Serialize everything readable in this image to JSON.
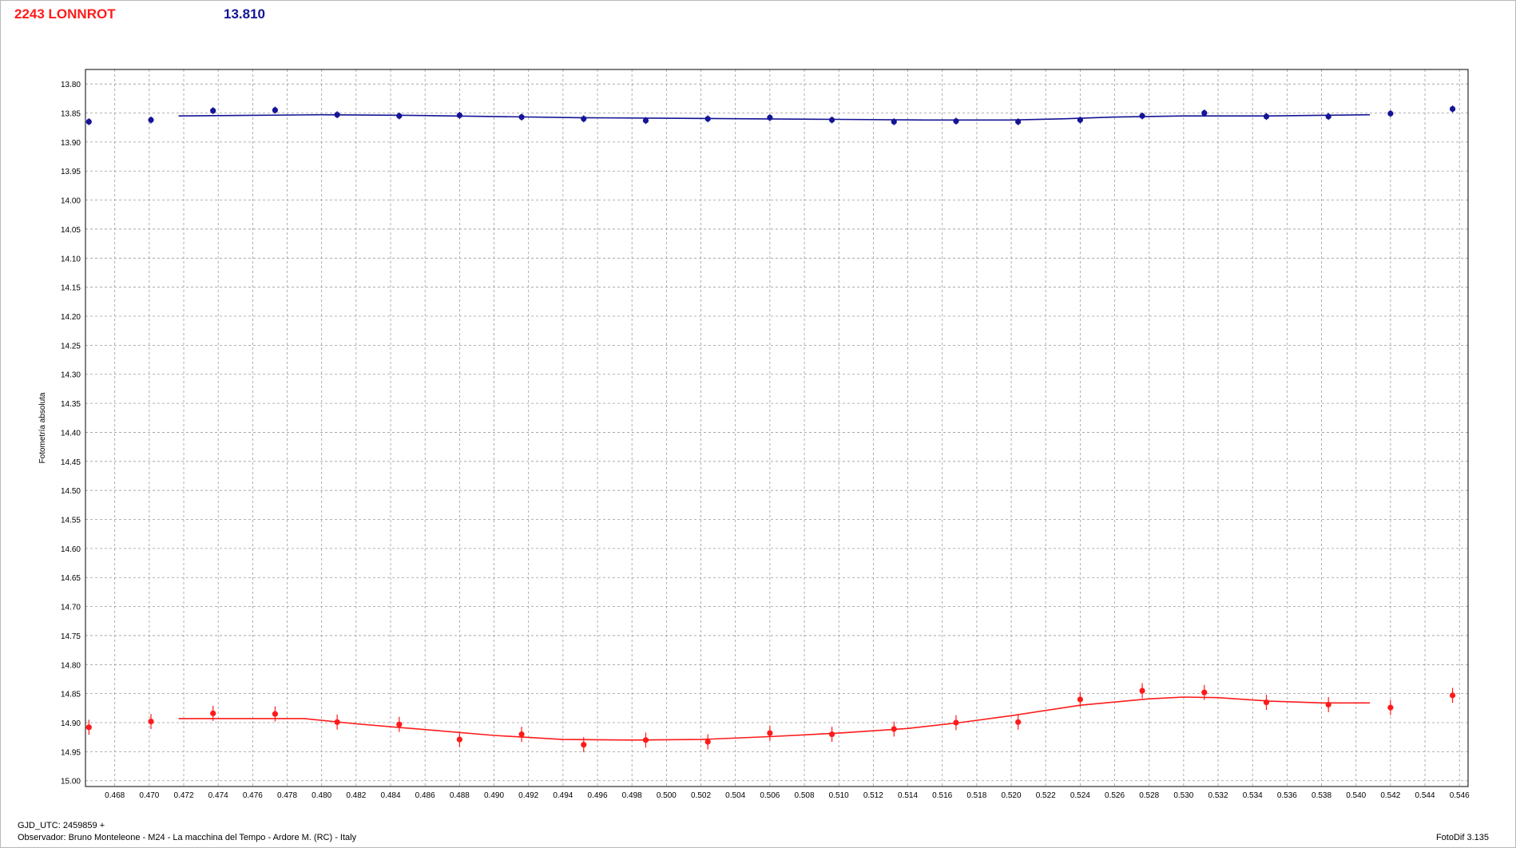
{
  "header": {
    "object_name": "2243 LONNROT",
    "reference_mag": "13.810"
  },
  "footer": {
    "gjd_label": "GJD_UTC: 2459859 +",
    "observer": "Observador: Bruno Monteleone - M24 - La macchina del Tempo - Ardore M. (RC) - Italy",
    "software": "FotoDif 3.135"
  },
  "colors": {
    "comparison": "#141496",
    "target": "#ff1a1a",
    "grid": "#9a9a9a"
  },
  "chart_data": {
    "type": "scatter",
    "title": "",
    "xlabel": "",
    "ylabel": "Fotometría absoluta",
    "xlim": [
      0.4663,
      0.5465
    ],
    "ylim": [
      13.775,
      15.01
    ],
    "y_inverted": true,
    "grid": true,
    "x_ticks": [
      "0.468",
      "0.470",
      "0.472",
      "0.474",
      "0.476",
      "0.478",
      "0.480",
      "0.482",
      "0.484",
      "0.486",
      "0.488",
      "0.490",
      "0.492",
      "0.494",
      "0.496",
      "0.498",
      "0.500",
      "0.502",
      "0.504",
      "0.506",
      "0.508",
      "0.510",
      "0.512",
      "0.514",
      "0.516",
      "0.518",
      "0.520",
      "0.522",
      "0.524",
      "0.526",
      "0.528",
      "0.530",
      "0.532",
      "0.534",
      "0.536",
      "0.538",
      "0.540",
      "0.542",
      "0.544",
      "0.546"
    ],
    "y_ticks": [
      "13.80",
      "13.85",
      "13.90",
      "13.95",
      "14.00",
      "14.05",
      "14.10",
      "14.15",
      "14.20",
      "14.25",
      "14.30",
      "14.35",
      "14.40",
      "14.45",
      "14.50",
      "14.55",
      "14.60",
      "14.65",
      "14.70",
      "14.75",
      "14.80",
      "14.85",
      "14.90",
      "14.95",
      "15.00"
    ],
    "series": [
      {
        "role": "comparison",
        "x": [
          0.4665,
          0.4701,
          0.4737,
          0.4773,
          0.4809,
          0.4845,
          0.488,
          0.4916,
          0.4952,
          0.4988,
          0.5024,
          0.506,
          0.5096,
          0.5132,
          0.5168,
          0.5204,
          0.524,
          0.5276,
          0.5312,
          0.5348,
          0.5384,
          0.542,
          0.5456
        ],
        "y": [
          13.865,
          13.862,
          13.846,
          13.845,
          13.853,
          13.855,
          13.854,
          13.857,
          13.86,
          13.863,
          13.86,
          13.858,
          13.862,
          13.865,
          13.864,
          13.865,
          13.862,
          13.855,
          13.85,
          13.856,
          13.856,
          13.851,
          13.843
        ],
        "err": [
          0.006,
          0.006,
          0.006,
          0.006,
          0.006,
          0.006,
          0.006,
          0.006,
          0.006,
          0.006,
          0.006,
          0.006,
          0.006,
          0.006,
          0.006,
          0.006,
          0.006,
          0.006,
          0.006,
          0.006,
          0.006,
          0.006,
          0.006
        ],
        "fit_x": [
          0.4717,
          0.476,
          0.48,
          0.485,
          0.49,
          0.495,
          0.5,
          0.505,
          0.51,
          0.515,
          0.52,
          0.523,
          0.526,
          0.53,
          0.535,
          0.538,
          0.5408
        ],
        "fit_y": [
          13.855,
          13.854,
          13.853,
          13.854,
          13.856,
          13.858,
          13.859,
          13.86,
          13.861,
          13.862,
          13.862,
          13.86,
          13.857,
          13.855,
          13.855,
          13.854,
          13.853
        ]
      },
      {
        "role": "target",
        "x": [
          0.4665,
          0.4701,
          0.4737,
          0.4773,
          0.4809,
          0.4845,
          0.488,
          0.4916,
          0.4952,
          0.4988,
          0.5024,
          0.506,
          0.5096,
          0.5132,
          0.5168,
          0.5204,
          0.524,
          0.5276,
          0.5312,
          0.5348,
          0.5384,
          0.542,
          0.5456
        ],
        "y": [
          14.908,
          14.898,
          14.884,
          14.885,
          14.899,
          14.903,
          14.929,
          14.92,
          14.938,
          14.93,
          14.933,
          14.918,
          14.92,
          14.911,
          14.9,
          14.899,
          14.86,
          14.845,
          14.848,
          14.865,
          14.869,
          14.874,
          14.853
        ],
        "err": [
          0.013,
          0.013,
          0.013,
          0.013,
          0.013,
          0.013,
          0.013,
          0.013,
          0.013,
          0.013,
          0.013,
          0.013,
          0.013,
          0.013,
          0.013,
          0.013,
          0.013,
          0.013,
          0.013,
          0.013,
          0.013,
          0.013,
          0.013
        ],
        "fit_x": [
          0.4717,
          0.476,
          0.479,
          0.482,
          0.486,
          0.49,
          0.494,
          0.498,
          0.502,
          0.506,
          0.51,
          0.514,
          0.517,
          0.52,
          0.524,
          0.528,
          0.53,
          0.532,
          0.535,
          0.538,
          0.5408
        ],
        "fit_y": [
          14.893,
          14.893,
          14.893,
          14.902,
          14.912,
          14.922,
          14.929,
          14.93,
          14.929,
          14.924,
          14.918,
          14.91,
          14.9,
          14.888,
          14.87,
          14.859,
          14.856,
          14.857,
          14.863,
          14.866,
          14.866
        ]
      }
    ]
  }
}
